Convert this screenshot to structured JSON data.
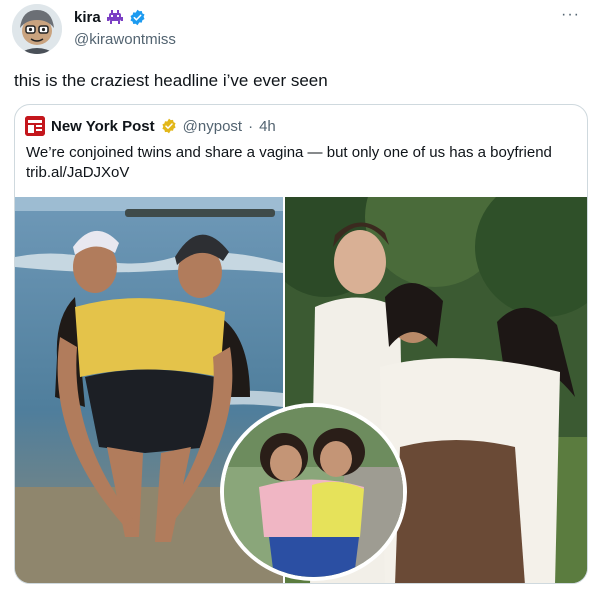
{
  "author": {
    "name": "kira",
    "handle": "@kirawontmiss",
    "badge_icon": "space-invader-icon",
    "verified_icon": "verified-badge-icon",
    "verified_color": "#1d9bf0"
  },
  "menu": {
    "more_label": "···"
  },
  "tweet": {
    "text": "this is the craziest headline i’ve ever seen"
  },
  "quote": {
    "name": "New York Post",
    "handle": "@nypost",
    "separator": "·",
    "time": "4h",
    "logo_icon": "new-york-post-logo",
    "verified_icon": "gold-verified-badge-icon",
    "verified_color": "#e2b719",
    "line1": "We’re conjoined twins and share a vagina — but only one of us has a boyfriend",
    "line2": "trib.al/JaDJXoV"
  },
  "colors": {
    "handle_gray": "#536471",
    "border": "#cfd9de",
    "post_red": "#c4161c"
  }
}
